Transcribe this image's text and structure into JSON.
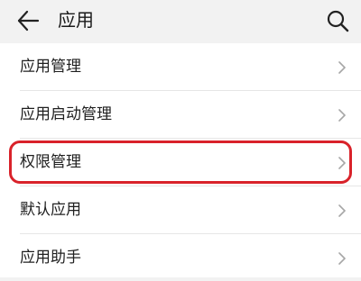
{
  "header": {
    "title": "应用",
    "back_icon": "back-arrow-icon",
    "search_icon": "search-icon"
  },
  "list": {
    "items": [
      {
        "label": "应用管理",
        "icon": "chevron-right-icon"
      },
      {
        "label": "应用启动管理",
        "icon": "chevron-right-icon"
      },
      {
        "label": "权限管理",
        "icon": "chevron-right-icon",
        "highlighted": true
      },
      {
        "label": "默认应用",
        "icon": "chevron-right-icon"
      },
      {
        "label": "应用助手",
        "icon": "chevron-right-icon"
      }
    ]
  },
  "colors": {
    "background": "#f2f2f2",
    "list_background": "#ffffff",
    "highlight": "#d9222a",
    "chevron": "#a6a6a6"
  }
}
